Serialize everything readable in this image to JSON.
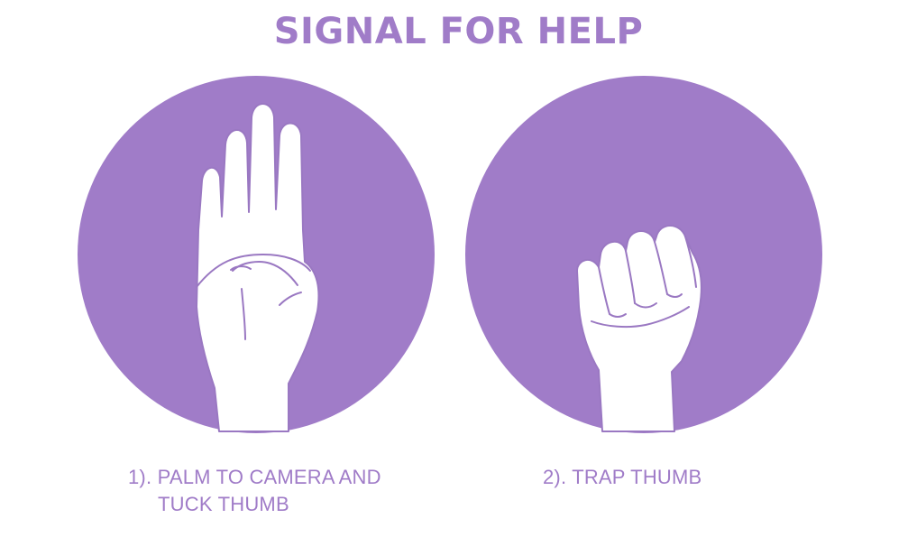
{
  "title": "SIGNAL FOR HELP",
  "colors": {
    "accent": "#a07cc8",
    "hand_fill": "#ffffff",
    "hand_outline": "#9a78c2"
  },
  "steps": [
    {
      "icon": "open-palm-thumb-tucked-icon",
      "caption_line1": "1). PALM TO CAMERA AND",
      "caption_line2": "TUCK THUMB"
    },
    {
      "icon": "fist-trapped-thumb-icon",
      "caption_line1": "2). TRAP THUMB"
    }
  ]
}
